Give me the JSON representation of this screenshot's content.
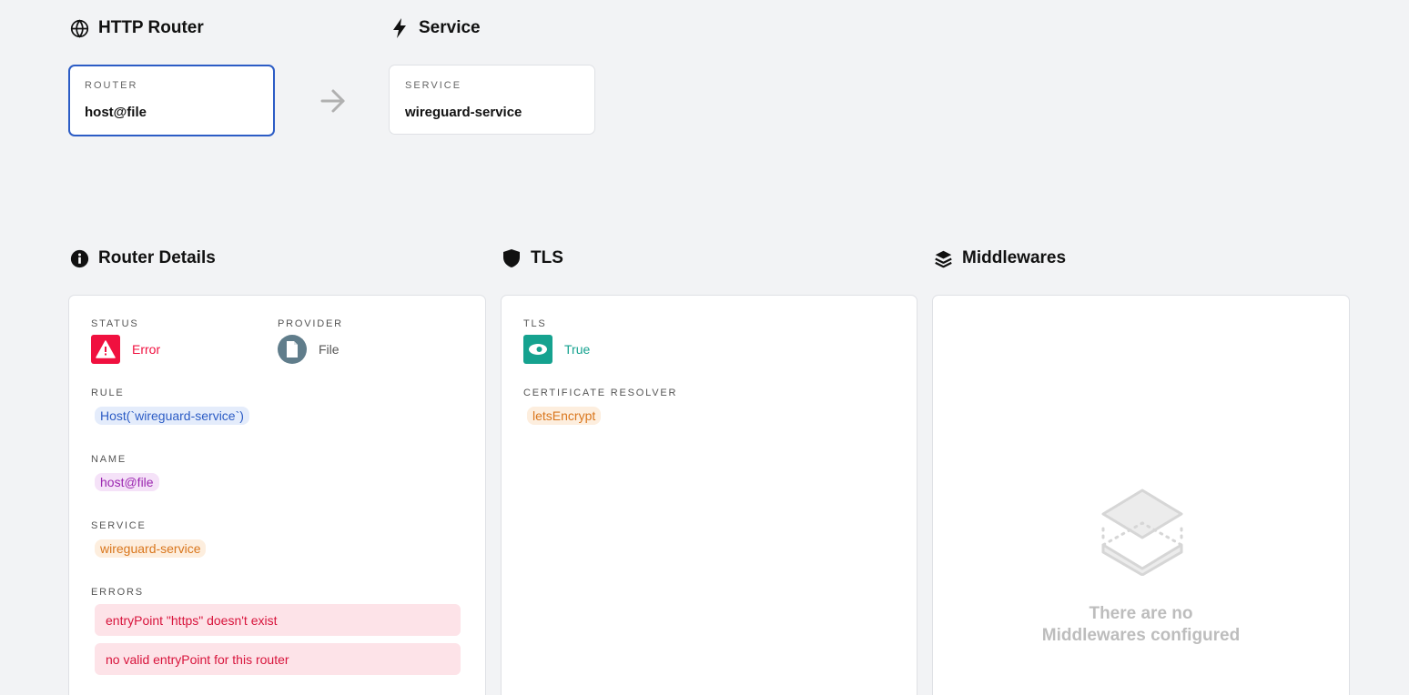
{
  "flow": {
    "router_section_title": "HTTP Router",
    "service_section_title": "Service",
    "router_card": {
      "label": "ROUTER",
      "value": "host@file"
    },
    "service_card": {
      "label": "SERVICE",
      "value": "wireguard-service"
    }
  },
  "router_details": {
    "title": "Router Details",
    "status": {
      "label": "STATUS",
      "value": "Error",
      "color": "#f0103f"
    },
    "provider": {
      "label": "PROVIDER",
      "value": "File",
      "color": "#607d8b"
    },
    "rule": {
      "label": "RULE",
      "value": "Host(`wireguard-service`)"
    },
    "name": {
      "label": "NAME",
      "value": "host@file"
    },
    "service": {
      "label": "SERVICE",
      "value": "wireguard-service"
    },
    "errors": {
      "label": "ERRORS",
      "items": [
        "entryPoint \"https\" doesn't exist",
        "no valid entryPoint for this router"
      ]
    }
  },
  "tls": {
    "title": "TLS",
    "tls_field": {
      "label": "TLS",
      "value": "True",
      "color": "#15a28f"
    },
    "resolver": {
      "label": "CERTIFICATE RESOLVER",
      "value": "letsEncrypt"
    }
  },
  "middlewares": {
    "title": "Middlewares",
    "empty_line1": "There are no",
    "empty_line2": "Middlewares configured"
  },
  "icons": {
    "http_router": "globe-icon",
    "service": "bolt-icon",
    "router_details": "info-icon",
    "tls": "shield-icon",
    "middlewares": "layers-icon",
    "status": "warning-icon",
    "provider": "file-icon",
    "tls_status": "eye-icon",
    "flow_arrow": "arrow-right-icon",
    "empty_middlewares": "empty-layers-icon"
  }
}
